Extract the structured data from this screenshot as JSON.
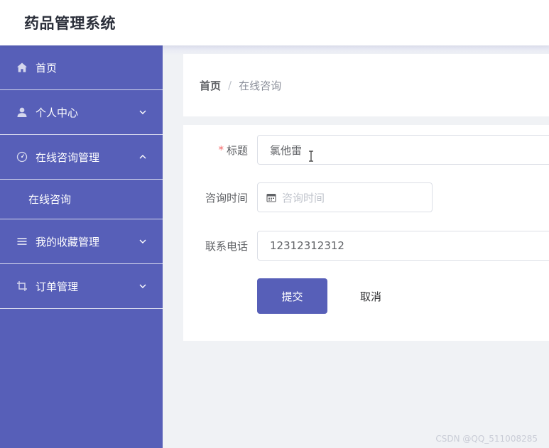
{
  "header": {
    "title": "药品管理系统"
  },
  "sidebar": {
    "items": [
      {
        "label": "首页",
        "icon": "home-icon"
      },
      {
        "label": "个人中心",
        "icon": "user-icon",
        "chevron": "chevron-down-icon"
      },
      {
        "label": "在线咨询管理",
        "icon": "dashboard-icon",
        "chevron": "chevron-up-icon",
        "children": [
          {
            "label": "在线咨询"
          }
        ]
      },
      {
        "label": "我的收藏管理",
        "icon": "list-icon",
        "chevron": "chevron-down-icon"
      },
      {
        "label": "订单管理",
        "icon": "crop-icon",
        "chevron": "chevron-down-icon"
      }
    ]
  },
  "breadcrumb": {
    "home": "首页",
    "separator": "/",
    "current": "在线咨询"
  },
  "form": {
    "title": {
      "label": "标题",
      "required_mark": "*",
      "value": "氯他雷"
    },
    "consult_time": {
      "label": "咨询时间",
      "placeholder": "咨询时间"
    },
    "phone": {
      "label": "联系电话",
      "value": "12312312312"
    },
    "submit_label": "提交",
    "cancel_label": "取消"
  },
  "watermark": "CSDN @QQ_511008285",
  "colors": {
    "sidebar": "#575fb8",
    "primary": "#575fb8",
    "required": "#f56c6c"
  }
}
